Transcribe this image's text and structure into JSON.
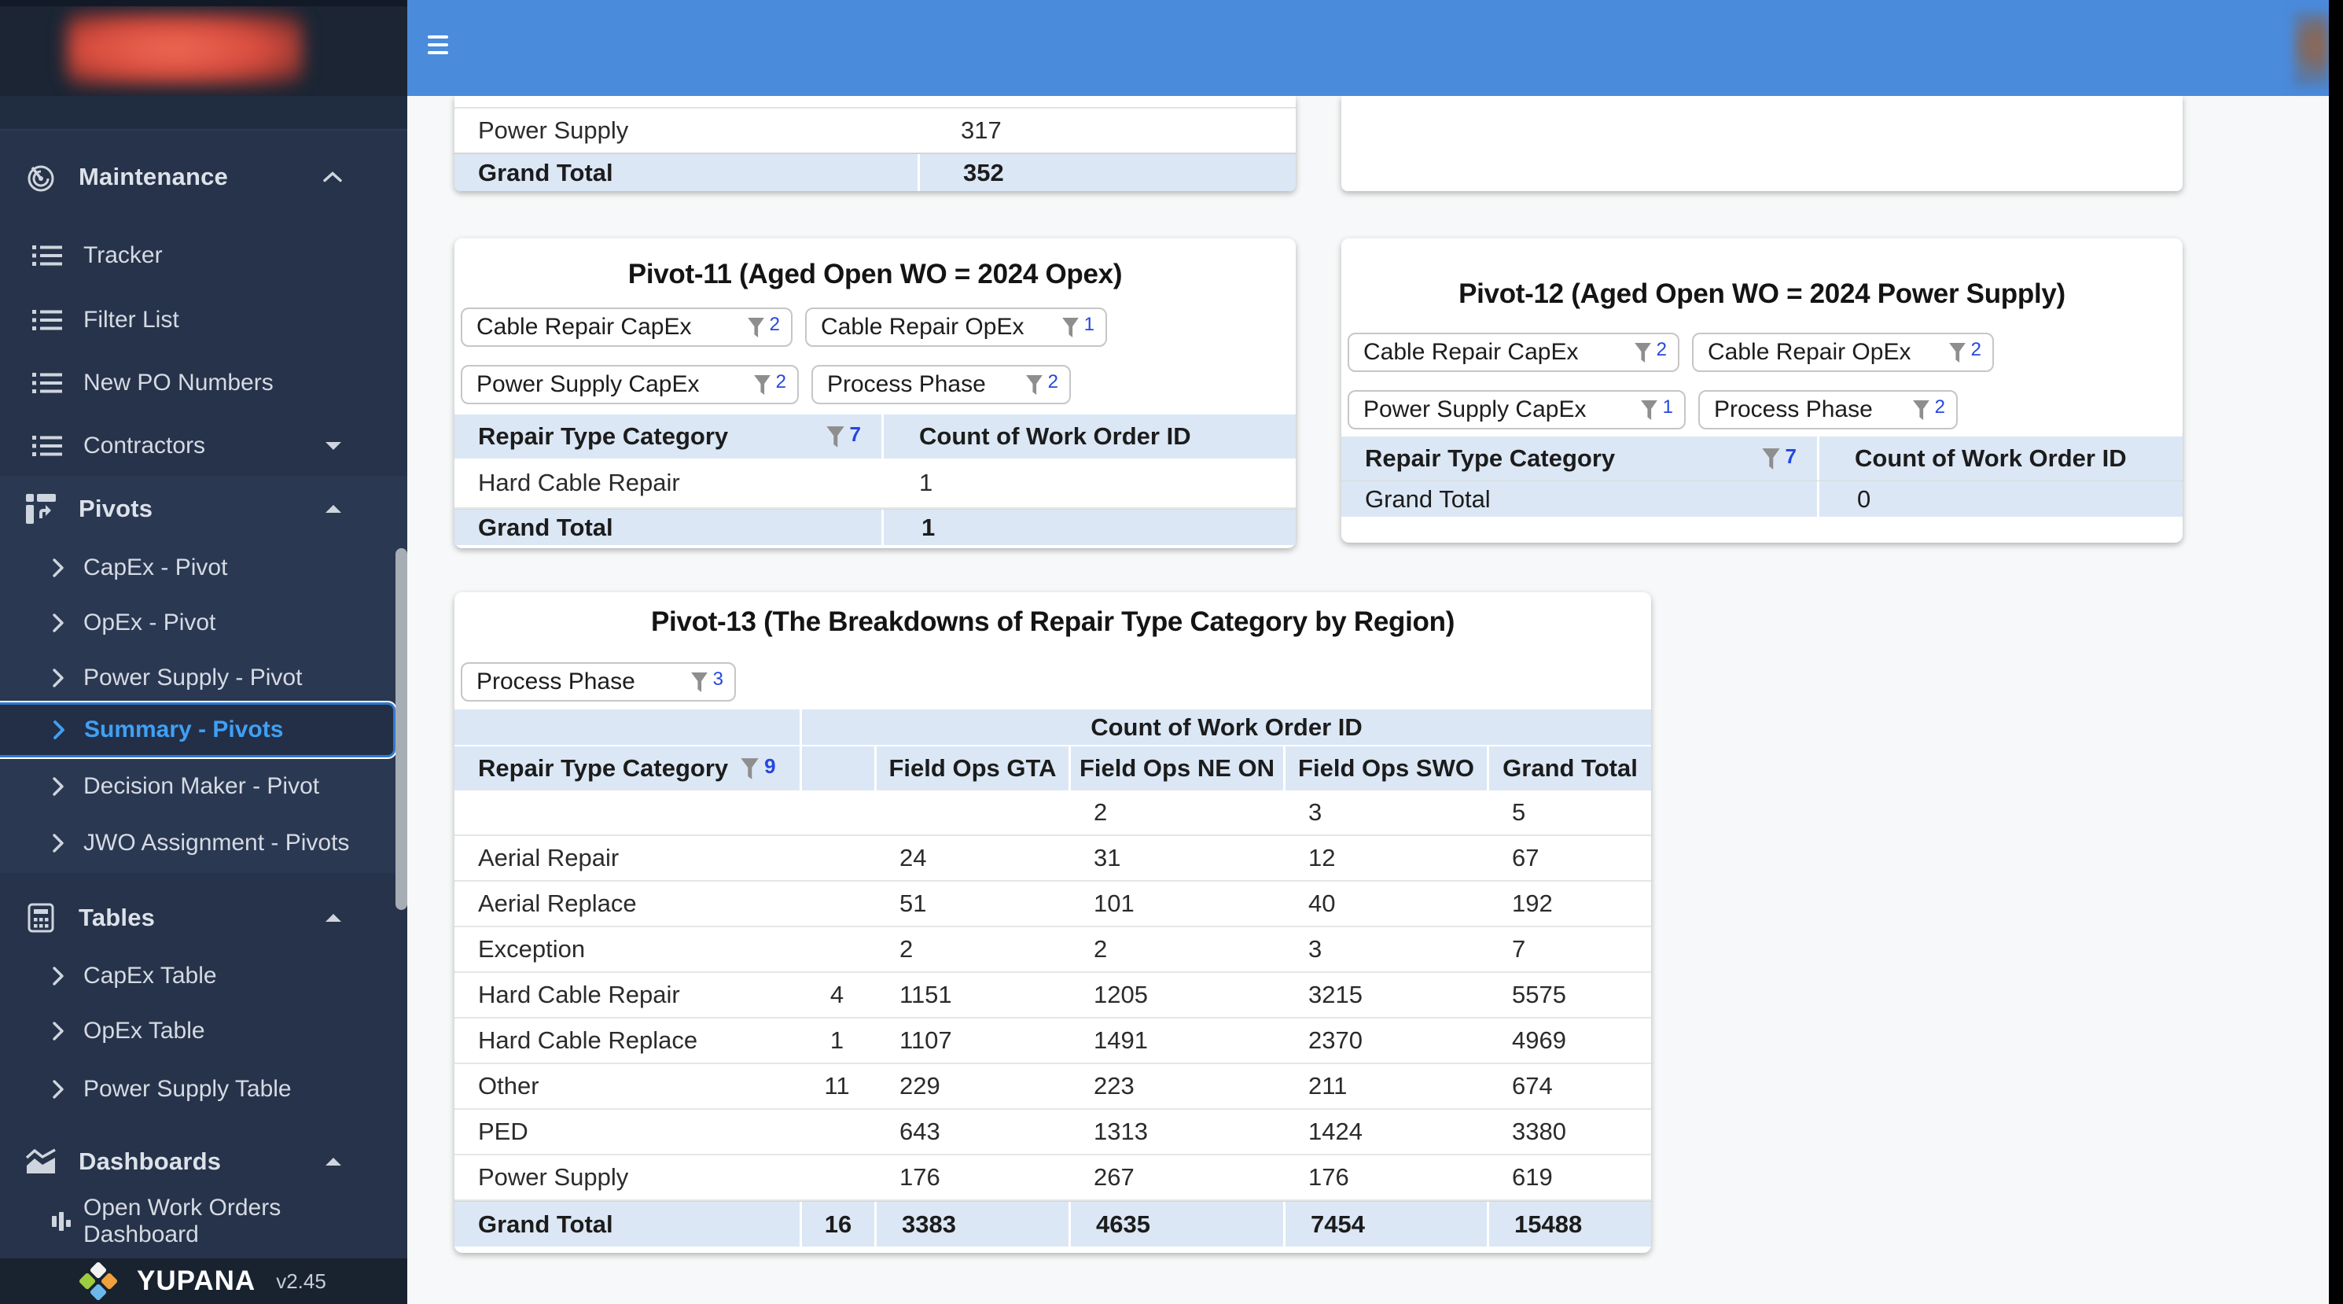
{
  "colors": {
    "appbar_blue": "#4a8bdc",
    "sidebar_bg": "#26334a",
    "active_item_blue": "#3fa0f5",
    "table_header_bg": "#dbe7f5",
    "filter_count_blue": "#2547e0",
    "logo_red": "#d84c3e"
  },
  "sidebar": {
    "groups": [
      {
        "label": "Maintenance",
        "icon": "track-changes-icon",
        "items": [
          "Tracker",
          "Filter List",
          "New PO Numbers",
          "Contractors"
        ]
      },
      {
        "label": "Pivots",
        "icon": "pivot-table-icon",
        "items": [
          "CapEx - Pivot",
          "OpEx - Pivot",
          "Power Supply - Pivot",
          "Summary - Pivots",
          "Decision Maker - Pivot",
          "JWO Assignment - Pivots"
        ]
      },
      {
        "label": "Tables",
        "icon": "table-icon",
        "items": [
          "CapEx Table",
          "OpEx Table",
          "Power Supply Table"
        ]
      },
      {
        "label": "Dashboards",
        "icon": "area-chart-icon",
        "items": [
          "Open Work Orders Dashboard"
        ]
      }
    ],
    "active_item": "Summary - Pivots",
    "footer": {
      "brand": "YUPANA",
      "version": "v2.45"
    }
  },
  "tables": {
    "top_partial": {
      "row": [
        "Power Supply",
        "317"
      ],
      "grand_total": [
        "Grand Total",
        "352"
      ]
    },
    "pivot11": {
      "title": "Pivot-11 (Aged Open WO = 2024 Opex)",
      "filters": [
        {
          "label": "Cable Repair CapEx",
          "count": "2"
        },
        {
          "label": "Cable Repair OpEx",
          "count": "1"
        },
        {
          "label": "Power Supply CapEx",
          "count": "2"
        },
        {
          "label": "Process Phase",
          "count": "2"
        }
      ],
      "row_header": "Repair Type Category",
      "row_header_filter_count": "7",
      "value_header": "Count of Work Order ID",
      "rows": [
        [
          "Hard Cable Repair",
          "1"
        ]
      ],
      "grand_total": [
        "Grand Total",
        "1"
      ]
    },
    "pivot12": {
      "title": "Pivot-12 (Aged Open WO = 2024 Power Supply)",
      "filters": [
        {
          "label": "Cable Repair CapEx",
          "count": "2"
        },
        {
          "label": "Cable Repair OpEx",
          "count": "2"
        },
        {
          "label": "Power Supply CapEx",
          "count": "1"
        },
        {
          "label": "Process Phase",
          "count": "2"
        }
      ],
      "row_header": "Repair Type Category",
      "row_header_filter_count": "7",
      "value_header": "Count of Work Order ID",
      "rows": [],
      "grand_total": [
        "Grand Total",
        "0"
      ]
    },
    "pivot13": {
      "title": "Pivot-13 (The Breakdowns of Repair Type Category by Region)",
      "filters": [
        {
          "label": "Process Phase",
          "count": "3"
        }
      ],
      "value_header": "Count of Work Order ID",
      "row_header": "Repair Type Category",
      "row_header_filter_count": "9",
      "columns": [
        "Field Ops GTA",
        "Field Ops NE ON",
        "Field Ops SWO",
        "Grand Total"
      ],
      "rows": [
        [
          "",
          "",
          "",
          "2",
          "3",
          "5"
        ],
        [
          "Aerial Repair",
          "",
          "24",
          "31",
          "12",
          "67"
        ],
        [
          "Aerial Replace",
          "",
          "51",
          "101",
          "40",
          "192"
        ],
        [
          "Exception",
          "",
          "2",
          "2",
          "3",
          "7"
        ],
        [
          "Hard Cable Repair",
          "4",
          "1151",
          "1205",
          "3215",
          "5575"
        ],
        [
          "Hard Cable Replace",
          "1",
          "1107",
          "1491",
          "2370",
          "4969"
        ],
        [
          "Other",
          "11",
          "229",
          "223",
          "211",
          "674"
        ],
        [
          "PED",
          "",
          "643",
          "1313",
          "1424",
          "3380"
        ],
        [
          "Power Supply",
          "",
          "176",
          "267",
          "176",
          "619"
        ]
      ],
      "grand_total": [
        "Grand Total",
        "16",
        "3383",
        "4635",
        "7454",
        "15488"
      ]
    }
  }
}
